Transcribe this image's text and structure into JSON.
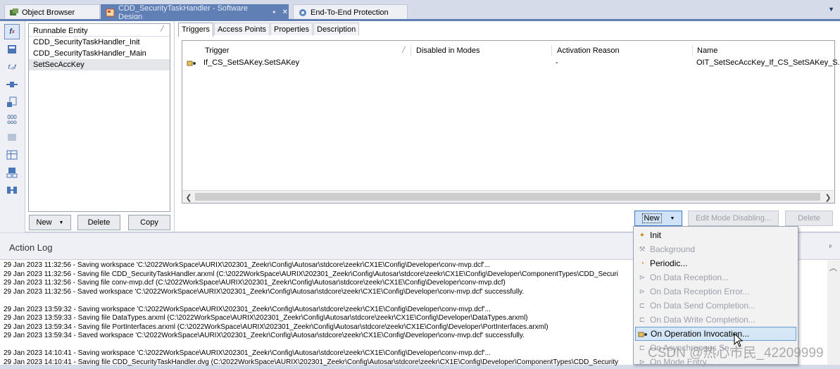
{
  "tabs": [
    {
      "label": "Object Browser",
      "active": false
    },
    {
      "label": "CDD_SecurityTaskHandler - Software Design",
      "active": true,
      "pin": "✦",
      "close": "✕"
    },
    {
      "label": "End-To-End Protection",
      "active": false
    }
  ],
  "toolbar_icons": [
    "function-icon",
    "entity-icon",
    "ffunction-icon",
    "port-icon",
    "component-icon",
    "dots-icon",
    "layer-icon",
    "grid-icon",
    "interface-icon",
    "mapping-icon"
  ],
  "runnable": {
    "header": "Runnable Entity",
    "items": [
      "CDD_SecurityTaskHandler_Init",
      "CDD_SecurityTaskHandler_Main",
      "SetSecAccKey"
    ],
    "selected_index": 2,
    "buttons": {
      "new": "New",
      "delete": "Delete",
      "copy": "Copy"
    }
  },
  "subtabs": [
    "Triggers",
    "Access Points",
    "Properties",
    "Description"
  ],
  "triggers": {
    "columns": [
      "Trigger",
      "Disabled in Modes",
      "Activation Reason",
      "Name"
    ],
    "rows": [
      {
        "trigger": "If_CS_SetSAKey.SetSAKey",
        "disabled": "",
        "reason": "-",
        "name": "OIT_SetSecAccKey_If_CS_SetSAKey_S..."
      }
    ],
    "buttons": {
      "new": "New",
      "edit": "Edit Mode Disabling...",
      "delete": "Delete"
    }
  },
  "action_log": {
    "title": "Action Log",
    "lines": [
      "29 Jan 2023 11:32:56 - Saving workspace 'C:\\2022WorkSpace\\AURIX\\202301_Zeekr\\Config\\Autosar\\stdcore\\zeekr\\CX1E\\Config\\Developer\\conv-mvp.dcf'...",
      "29 Jan 2023 11:32:56 - Saving file CDD_SecurityTaskHandler.arxml (C:\\2022WorkSpace\\AURIX\\202301_Zeekr\\Config\\Autosar\\stdcore\\zeekr\\CX1E\\Config\\Developer\\ComponentTypes\\CDD_Securi",
      "29 Jan 2023 11:32:56 - Saving file conv-mvp.dcf (C:\\2022WorkSpace\\AURIX\\202301_Zeekr\\Config\\Autosar\\stdcore\\zeekr\\CX1E\\Config\\Developer\\conv-mvp.dcf)",
      "29 Jan 2023 11:32:56 - Saved workspace 'C:\\2022WorkSpace\\AURIX\\202301_Zeekr\\Config\\Autosar\\stdcore\\zeekr\\CX1E\\Config\\Developer\\conv-mvp.dcf' successfully.",
      "",
      "29 Jan 2023 13:59:32 - Saving workspace 'C:\\2022WorkSpace\\AURIX\\202301_Zeekr\\Config\\Autosar\\stdcore\\zeekr\\CX1E\\Config\\Developer\\conv-mvp.dcf'...",
      "29 Jan 2023 13:59:33 - Saving file DataTypes.arxml (C:\\2022WorkSpace\\AURIX\\202301_Zeekr\\Config\\Autosar\\stdcore\\zeekr\\CX1E\\Config\\Developer\\DataTypes.arxml)",
      "29 Jan 2023 13:59:34 - Saving file PortInterfaces.arxml (C:\\2022WorkSpace\\AURIX\\202301_Zeekr\\Config\\Autosar\\stdcore\\zeekr\\CX1E\\Config\\Developer\\PortInterfaces.arxml)",
      "29 Jan 2023 13:59:34 - Saved workspace 'C:\\2022WorkSpace\\AURIX\\202301_Zeekr\\Config\\Autosar\\stdcore\\zeekr\\CX1E\\Config\\Developer\\conv-mvp.dcf' successfully.",
      "",
      "29 Jan 2023 14:10:41 - Saving workspace 'C:\\2022WorkSpace\\AURIX\\202301_Zeekr\\Config\\Autosar\\stdcore\\zeekr\\CX1E\\Config\\Developer\\conv-mvp.dcf'...",
      "29 Jan 2023 14:10:41 - Saving file CDD_SecurityTaskHandler.dvg (C:\\2022WorkSpace\\AURIX\\202301_Zeekr\\Config\\Autosar\\stdcore\\zeekr\\CX1E\\Config\\Developer\\ComponentTypes\\CDD_Security"
    ]
  },
  "new_menu": {
    "items": [
      {
        "label": "Init",
        "enabled": true,
        "icon": "init-icon"
      },
      {
        "label": "Background",
        "enabled": false,
        "icon": "background-icon"
      },
      {
        "label": "Periodic...",
        "enabled": true,
        "icon": "periodic-icon"
      },
      {
        "label": "On Data Reception...",
        "enabled": false,
        "icon": "data-reception-icon"
      },
      {
        "label": "On Data Reception Error...",
        "enabled": false,
        "icon": "data-reception-error-icon"
      },
      {
        "label": "On Data Send Completion...",
        "enabled": false,
        "icon": "data-send-icon"
      },
      {
        "label": "On Data Write Completion...",
        "enabled": false,
        "icon": "data-write-icon"
      },
      {
        "label": "On Operation Invocation...",
        "enabled": true,
        "highlighted": true,
        "icon": "operation-icon"
      },
      {
        "label": "On Asynchronous Se...",
        "enabled": false,
        "icon": "async-icon"
      },
      {
        "label": "On Mode Entry...",
        "enabled": false,
        "icon": "mode-entry-icon"
      }
    ]
  },
  "watermark": "CSDN @热心市民_42209999",
  "colors": {
    "accent": "#5f7fb5",
    "highlight": "#d5e6f7"
  }
}
